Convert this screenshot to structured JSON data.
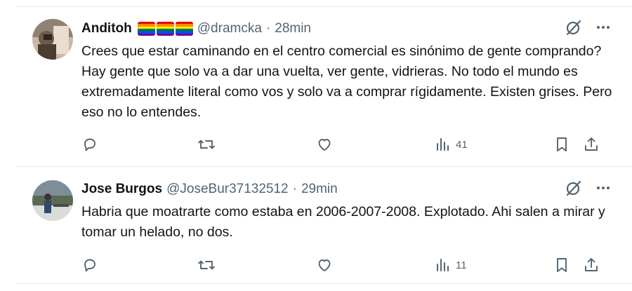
{
  "tweets": [
    {
      "name": "Anditoh",
      "handle": "@dramcka",
      "separator": "·",
      "time": "28min",
      "has_flags": true,
      "flag_colors": [
        "#e40303",
        "#ff8c00",
        "#ffed00",
        "#008026",
        "#004dff",
        "#750787"
      ],
      "text": "Crees  que estar caminando en el centro comercial es sinónimo de gente comprando? Hay gente que solo va a dar una vuelta, ver gente, vidrieras. No todo el mundo es extremadamente literal como vos y solo va a comprar rígidamente. Existen grises. Pero eso no lo entendes.",
      "views": "41"
    },
    {
      "name": "Jose Burgos",
      "handle": "@JoseBur37132512",
      "separator": "·",
      "time": "29min",
      "has_flags": false,
      "text": "Habria que moatrarte como estaba en 2006-2007-2008. Explotado. Ahi salen a mirar y tomar un helado, no dos.",
      "views": "11"
    }
  ],
  "icons": {
    "reply": "reply-icon",
    "retweet": "retweet-icon",
    "like": "heart-icon",
    "views": "views-chart-icon",
    "bookmark": "bookmark-icon",
    "share": "share-icon",
    "grok": "grok-icon",
    "more": "more-icon"
  },
  "colors": {
    "text": "#0f1419",
    "secondary": "#536471",
    "divider": "#e6ecf0"
  }
}
